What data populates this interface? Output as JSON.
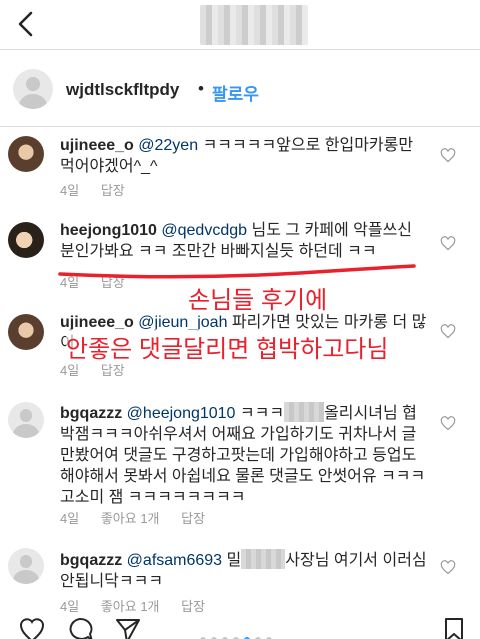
{
  "post": {
    "author": "wjdtlsckfltpdy",
    "separator": "•",
    "follow_label": "팔로우"
  },
  "comments": [
    {
      "user": "ujineee_o",
      "mention": "@22yen",
      "text": "ㅋㅋㅋㅋㅋ앞으로 한입마카롱만 먹어야겠어^_^",
      "time": "4일",
      "reply": "답장"
    },
    {
      "user": "heejong1010",
      "mention": "@qedvcdgb",
      "text": "님도 그 카페에 악플쓰신 분인가봐요 ㅋㅋ 조만간 바빠지실듯 하던데 ㅋㅋ",
      "time": "4일",
      "reply": "답장"
    },
    {
      "user": "ujineee_o",
      "mention": "@jieun_joah",
      "text": "파리가면 맛있는 마카롱 더 많이",
      "time": "4일",
      "reply": "답장"
    },
    {
      "user": "bgqazzz",
      "mention": "@heejong1010",
      "text_a": "ㅋㅋㅋ",
      "text_b": "올리시녀님 협박잼ㅋㅋㅋ아쉬우셔서 어째요 가입하기도 귀차나서 글만봤어여 댓글도 구경하고팟는데 가입해야하고 등업도해야해서 못봐서 아쉽네요 물론 댓글도 안썻어유 ㅋㅋㅋ고소미 잼 ㅋㅋㅋㅋㅋㅋㅋㅋ",
      "time": "4일",
      "likes": "좋아요 1개",
      "reply": "답장"
    },
    {
      "user": "bgqazzz",
      "mention": "@afsam6693",
      "text_a": "밀",
      "text_b": "사장님 여기서 이러심 안됩니닥ㅋㅋㅋ",
      "time": "4일",
      "likes": "좋아요 1개",
      "reply": "답장"
    }
  ],
  "annotations": {
    "line1": "손님들 후기에",
    "line2": "안좋은 댓글달리면 협박하고다님"
  },
  "colors": {
    "annotation": "#e8212c",
    "follow": "#3897f0",
    "mention": "#003569"
  }
}
